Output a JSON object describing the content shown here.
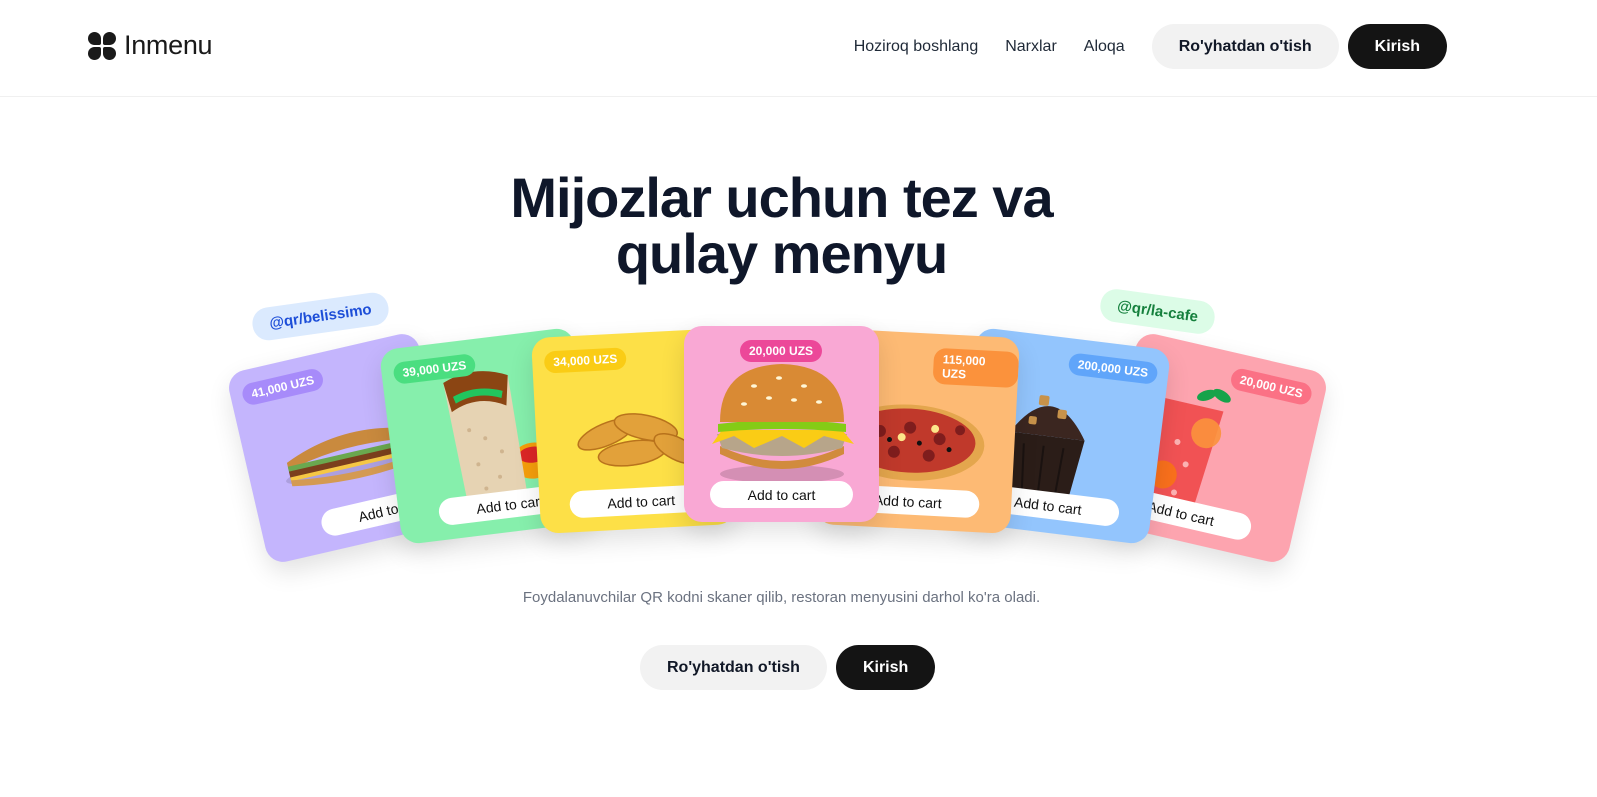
{
  "header": {
    "logo_text": "Inmenu",
    "nav": [
      "Hoziroq boshlang",
      "Narxlar",
      "Aloqa"
    ],
    "register_label": "Ro'yhatdan o'tish",
    "login_label": "Kirish"
  },
  "hero": {
    "title_line1": "Mijozlar uchun tez va",
    "title_line2": "qulay menyu",
    "subtitle": "Foydalanuvchilar QR kodni skaner qilib, restoran menyusini darhol ko'ra oladi.",
    "register_label": "Ro'yhatdan o'tish",
    "login_label": "Kirish"
  },
  "tags": {
    "left": "@qr/belissimo",
    "right": "@qr/la-cafe"
  },
  "cards": [
    {
      "price": "41,000 UZS",
      "button": "Add to cart",
      "food_icon": "sandwich-icon",
      "bg": "#c4b5fd",
      "badge": "#a78bfa"
    },
    {
      "price": "39,000 UZS",
      "button": "Add to cart",
      "food_icon": "wrap-icon",
      "bg": "#86efac",
      "badge": "#4ade80"
    },
    {
      "price": "34,000 UZS",
      "button": "Add to cart",
      "food_icon": "chicken-strips-icon",
      "bg": "#fde047",
      "badge": "#facc15"
    },
    {
      "price": "20,000 UZS",
      "button": "Add to cart",
      "food_icon": "burger-icon",
      "bg": "#f9a8d4",
      "badge": "#ec4899"
    },
    {
      "price": "115,000 UZS",
      "button": "Add to cart",
      "food_icon": "pizza-icon",
      "bg": "#fdba74",
      "badge": "#fb923c"
    },
    {
      "price": "200,000 UZS",
      "button": "Add to cart",
      "food_icon": "muffin-icon",
      "bg": "#93c5fd",
      "badge": "#60a5fa"
    },
    {
      "price": "20,000 UZS",
      "button": "Add to cart",
      "food_icon": "drink-icon",
      "bg": "#fda4af",
      "badge": "#fb7185"
    }
  ]
}
